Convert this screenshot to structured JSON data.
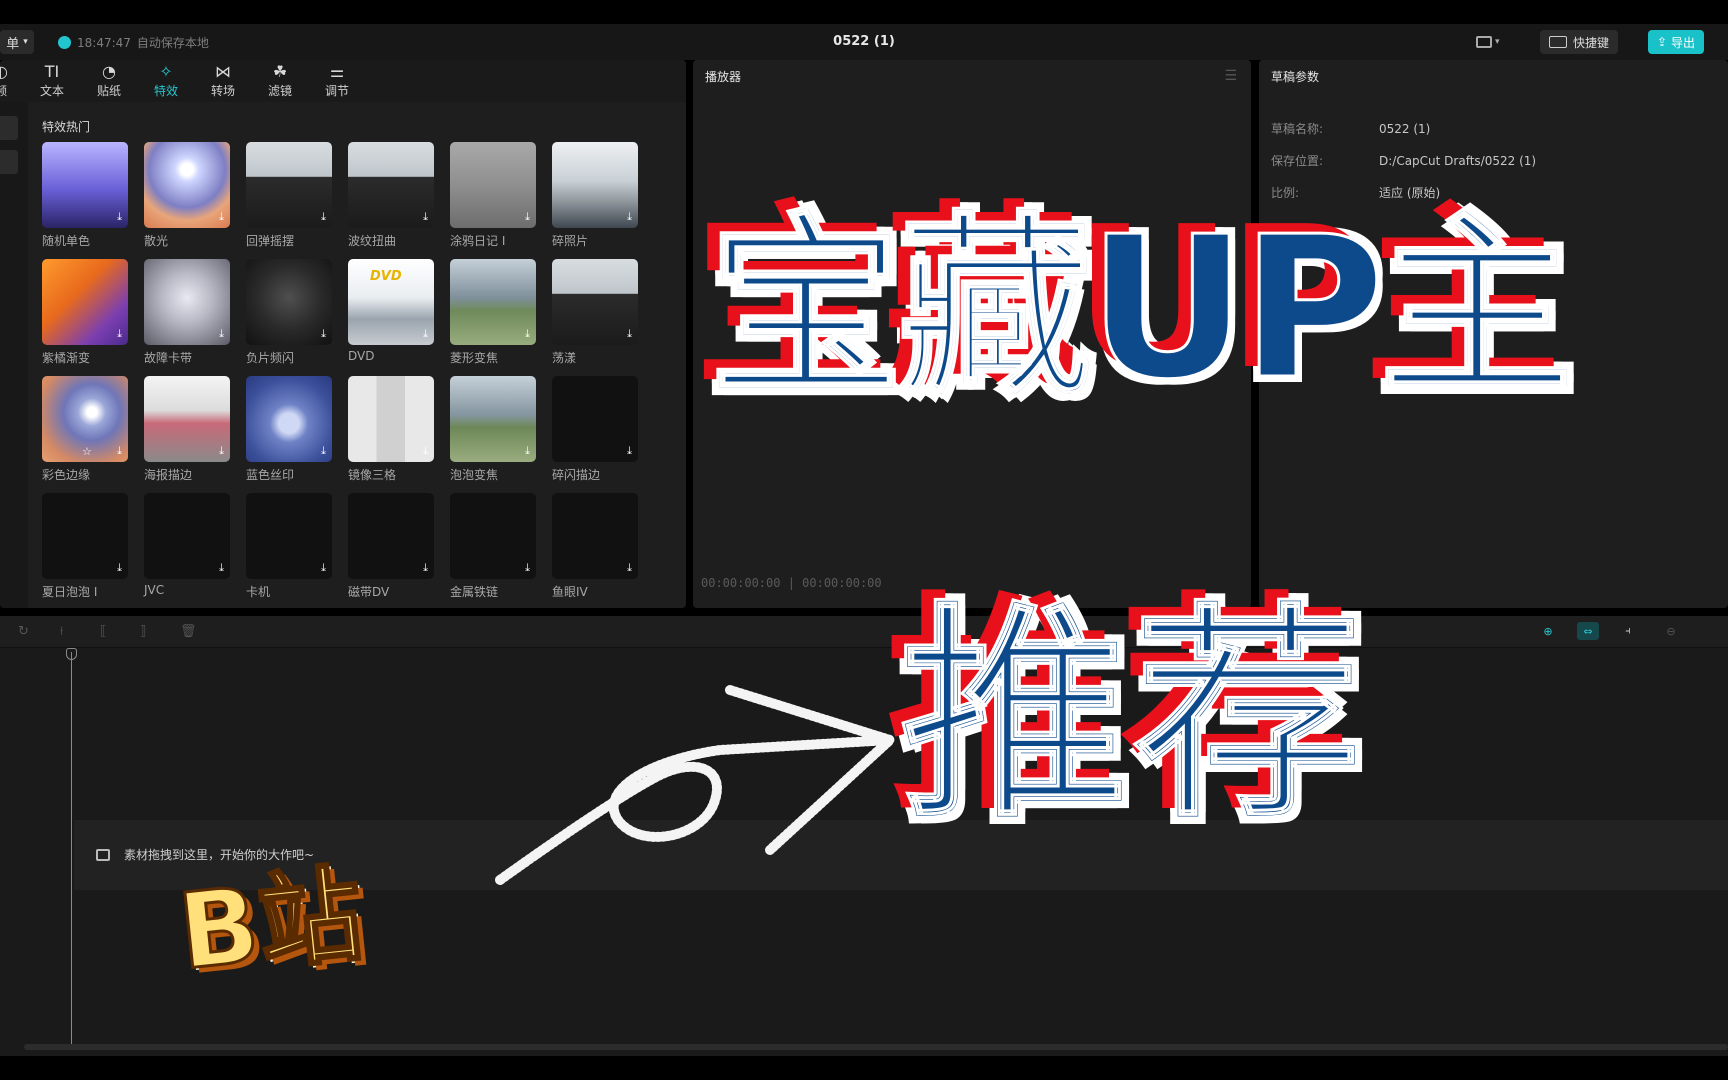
{
  "titlebar": {
    "menu_label": "单",
    "autosave_time": "18:47:47",
    "autosave_text": "自动保存本地",
    "project_title": "0522 (1)",
    "shortcut_label": "快捷键",
    "export_label": "导出"
  },
  "toolbar": {
    "tools": [
      {
        "label": "频",
        "icon": "media-icon"
      },
      {
        "label": "文本",
        "icon": "text-icon"
      },
      {
        "label": "贴纸",
        "icon": "sticker-icon"
      },
      {
        "label": "特效",
        "icon": "effects-icon"
      },
      {
        "label": "转场",
        "icon": "transition-icon"
      },
      {
        "label": "滤镜",
        "icon": "filter-icon"
      },
      {
        "label": "调节",
        "icon": "adjust-icon"
      }
    ],
    "active": "特效"
  },
  "effects": {
    "section_title": "特效热门",
    "items": [
      {
        "label": "随机单色"
      },
      {
        "label": "散光"
      },
      {
        "label": "回弹摇摆"
      },
      {
        "label": "波纹扭曲"
      },
      {
        "label": "涂鸦日记 I"
      },
      {
        "label": "碎照片"
      },
      {
        "label": "紫橘渐变"
      },
      {
        "label": "故障卡带"
      },
      {
        "label": "负片频闪"
      },
      {
        "label": "DVD"
      },
      {
        "label": "菱形变焦"
      },
      {
        "label": "荡漾"
      },
      {
        "label": "彩色边缘"
      },
      {
        "label": "海报描边"
      },
      {
        "label": "蓝色丝印"
      },
      {
        "label": "镜像三格"
      },
      {
        "label": "泡泡变焦"
      },
      {
        "label": "碎闪描边"
      },
      {
        "label": "夏日泡泡 I"
      },
      {
        "label": "JVC"
      },
      {
        "label": "卡机"
      },
      {
        "label": "磁带DV"
      },
      {
        "label": "金属铁链"
      },
      {
        "label": "鱼眼IV"
      }
    ]
  },
  "player": {
    "title": "播放器",
    "timecode": "00:00:00:00  |  00:00:00:00"
  },
  "draft": {
    "title": "草稿参数",
    "rows": [
      {
        "key": "草稿名称:",
        "value": "0522 (1)"
      },
      {
        "key": "保存位置:",
        "value": "D:/CapCut Drafts/0522 (1)"
      },
      {
        "key": "比例:",
        "value": "适应 (原始)"
      }
    ]
  },
  "timeline": {
    "hint": "素材拖拽到这里，开始你的大作吧~"
  },
  "overlay": {
    "title_line1": "宝藏UP主",
    "title_line2": "推荐",
    "badge": "B站"
  }
}
